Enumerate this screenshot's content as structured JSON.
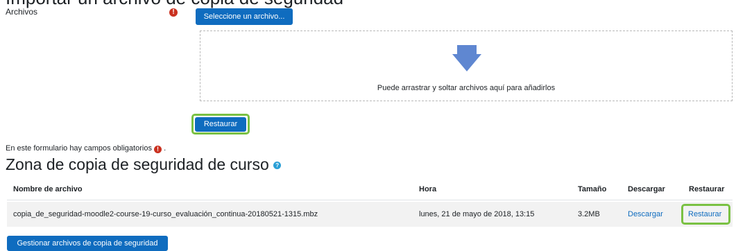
{
  "form": {
    "clipped_heading": "Importar un archivo de copia de seguridad",
    "files_label": "Archivos",
    "required_icon": "exclamation-circle-icon",
    "choose_file_button": "Seleccione un archivo...",
    "dropzone_text": "Puede arrastrar y soltar archivos aquí para añadirlos",
    "restore_button": "Restaurar",
    "required_note": "En este formulario hay campos obligatorios",
    "required_note_suffix": "."
  },
  "backup_area": {
    "title": "Zona de copia de seguridad de curso",
    "help_icon": "question-circle-icon",
    "columns": [
      "Nombre de archivo",
      "Hora",
      "Tamaño",
      "Descargar",
      "Restaurar"
    ],
    "rows": [
      {
        "filename": "copia_de_seguridad-moodle2-course-19-curso_evaluación_continua-20180521-1315.mbz",
        "time": "lunes, 21 de mayo de 2018, 13:15",
        "size": "3.2MB",
        "download": "Descargar",
        "restore": "Restaurar"
      }
    ],
    "manage_button": "Gestionar archivos de copia de seguridad"
  },
  "colors": {
    "primary": "#0f6cbf",
    "required": "#ca3120",
    "highlight": "#7ac143"
  }
}
